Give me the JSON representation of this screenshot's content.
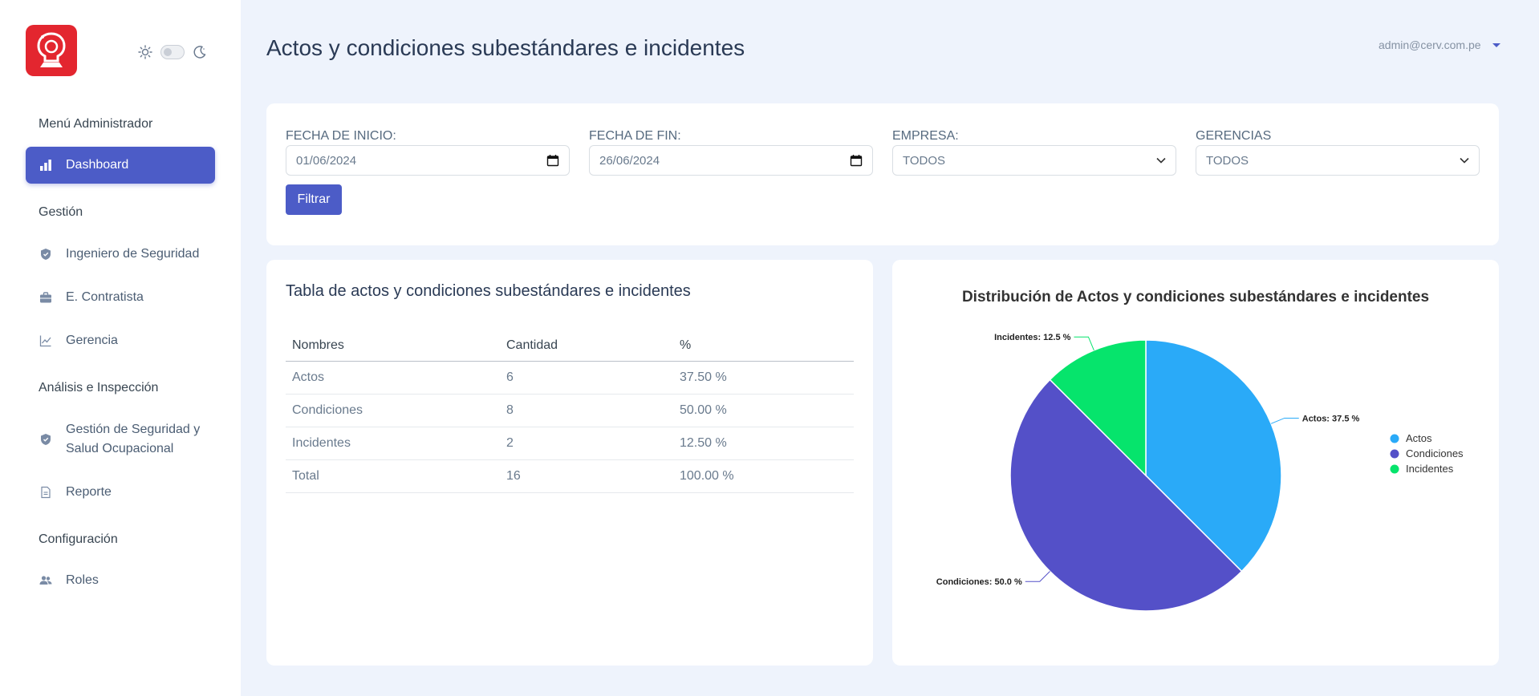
{
  "sidebar": {
    "menu_header": "Menú Administrador",
    "items": [
      {
        "label": "Dashboard",
        "icon": "bar-chart-icon"
      },
      {
        "label": "Ingeniero de Seguridad",
        "icon": "shield-icon"
      },
      {
        "label": "E. Contratista",
        "icon": "briefcase-icon"
      },
      {
        "label": "Gerencia",
        "icon": "line-chart-icon"
      },
      {
        "label": "Gestión de Seguridad y Salud Ocupacional",
        "icon": "shield-icon"
      },
      {
        "label": "Reporte",
        "icon": "file-icon"
      },
      {
        "label": "Roles",
        "icon": "users-icon"
      }
    ],
    "sections": {
      "gestion": "Gestión",
      "analisis": "Análisis e Inspección",
      "configuracion": "Configuración"
    }
  },
  "header": {
    "title": "Actos y condiciones subestándares e incidentes",
    "user_email": "admin@cerv.com.pe"
  },
  "filters": {
    "fecha_inicio": {
      "label": "FECHA DE INICIO:",
      "value": "01/06/2024"
    },
    "fecha_fin": {
      "label": "FECHA DE FIN:",
      "value": "26/06/2024"
    },
    "empresa": {
      "label": "EMPRESA:",
      "value": "TODOS"
    },
    "gerencias": {
      "label": "GERENCIAS",
      "value": "TODOS"
    },
    "button_label": "Filtrar"
  },
  "table": {
    "title": "Tabla de actos y condiciones subestándares e incidentes",
    "columns": [
      "Nombres",
      "Cantidad",
      "%"
    ],
    "rows": [
      [
        "Actos",
        "6",
        "37.50 %"
      ],
      [
        "Condiciones",
        "8",
        "50.00 %"
      ],
      [
        "Incidentes",
        "2",
        "12.50 %"
      ],
      [
        "Total",
        "16",
        "100.00 %"
      ]
    ]
  },
  "colors": {
    "accent": "#4c5cc7",
    "actos": "#2aaaf8",
    "condiciones": "#5450c8",
    "incidentes": "#06e46c"
  },
  "chart_data": {
    "type": "pie",
    "title": "Distribución de Actos y condiciones subestándares e incidentes",
    "categories": [
      "Actos",
      "Condiciones",
      "Incidentes"
    ],
    "values": [
      37.5,
      50.0,
      12.5
    ],
    "data_labels": [
      "Actos: 37.5 %",
      "Condiciones: 50.0 %",
      "Incidentes: 12.5 %"
    ],
    "colors": [
      "#2aaaf8",
      "#5450c8",
      "#06e46c"
    ],
    "legend_position": "right"
  }
}
